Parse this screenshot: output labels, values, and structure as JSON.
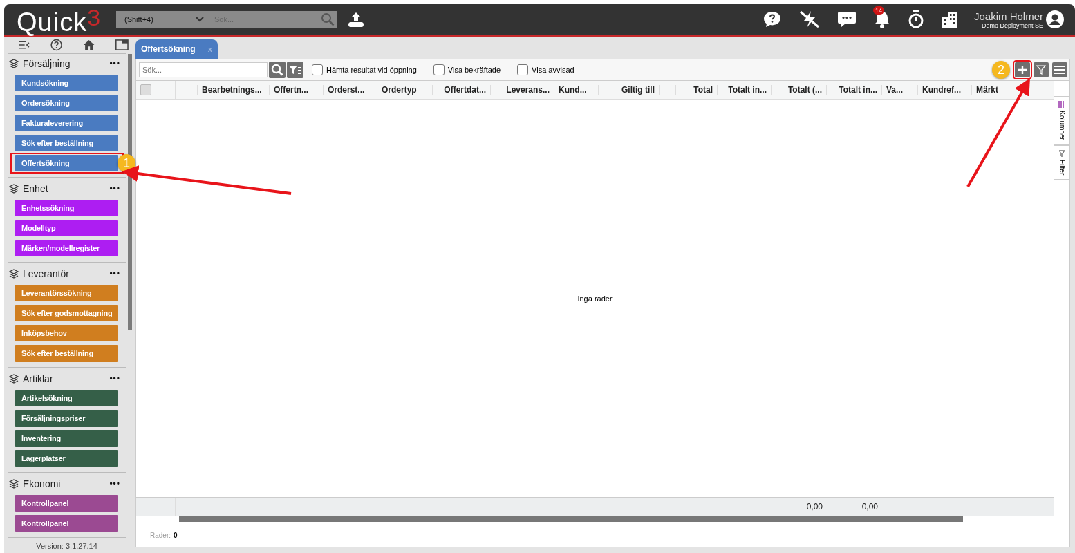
{
  "topbar": {
    "logo": "Quick",
    "logo_sup": "3",
    "scope": "(Shift+4)",
    "search_placeholder": "Sök...",
    "notification_count": "14",
    "user_name": "Joakim Holmer",
    "user_sub": "Demo Deployment SE"
  },
  "sidebar": {
    "groups": [
      {
        "title": "Försäljning",
        "more": "•••",
        "color": "#4a7bc1",
        "items": [
          {
            "label": "Kundsökning"
          },
          {
            "label": "Ordersökning"
          },
          {
            "label": "Fakturaleverering"
          },
          {
            "label": "Sök efter beställning"
          },
          {
            "label": "Offertsökning",
            "callout": "1"
          }
        ]
      },
      {
        "title": "Enhet",
        "more": "•••",
        "color": "#ad1ef2",
        "items": [
          {
            "label": "Enhetssökning"
          },
          {
            "label": "Modelltyp"
          },
          {
            "label": "Märken/modellregister"
          }
        ]
      },
      {
        "title": "Leverantör",
        "more": "•••",
        "color": "#d07e1f",
        "items": [
          {
            "label": "Leverantörssökning"
          },
          {
            "label": "Sök efter godsmottagning"
          },
          {
            "label": "Inköpsbehov"
          },
          {
            "label": "Sök efter beställning"
          }
        ]
      },
      {
        "title": "Artiklar",
        "more": "•••",
        "color": "#355f48",
        "items": [
          {
            "label": "Artikelsökning"
          },
          {
            "label": "Försäljningspriser"
          },
          {
            "label": "Inventering"
          },
          {
            "label": "Lagerplatser"
          }
        ]
      },
      {
        "title": "Ekonomi",
        "more": "•••",
        "color": "#9b4a92",
        "items": [
          {
            "label": "Kontrollpanel"
          },
          {
            "label": "Kontrollpanel"
          }
        ]
      }
    ],
    "version": "Version: 3.1.27.14"
  },
  "tabs": [
    {
      "label": "Offertsökning",
      "close": "x",
      "selected": true
    }
  ],
  "toolbar": {
    "search_placeholder": "Sök...",
    "options": [
      {
        "label": "Hämta resultat vid öppning",
        "checked": false
      },
      {
        "label": "Visa bekräftade",
        "checked": false
      },
      {
        "label": "Visa avvisad",
        "checked": false
      }
    ],
    "add_callout": "2"
  },
  "table": {
    "columns": [
      {},
      {
        "label": "Bearbetnings..."
      },
      {
        "label": "Offertn..."
      },
      {
        "label": "Orderst..."
      },
      {
        "label": "Ordertyp"
      },
      {
        "label": "Offertdat..."
      },
      {
        "label": "Leverans..."
      },
      {
        "label": "Kund..."
      },
      {
        "label": "Giltig till"
      },
      {},
      {
        "label": "Total"
      },
      {
        "label": "Totalt in..."
      },
      {
        "label": "Totalt (...",
        "total": "0,00"
      },
      {
        "label": "Totalt in...",
        "total": "0,00"
      },
      {
        "label": "Va..."
      },
      {
        "label": "Kundref..."
      },
      {
        "label": "Märkt"
      }
    ],
    "select_all_checked": false,
    "empty_text": "Inga rader",
    "side_tabs": [
      "Kolumner",
      "Filter"
    ],
    "rows_label": "Rader:",
    "rows_count": "0"
  }
}
